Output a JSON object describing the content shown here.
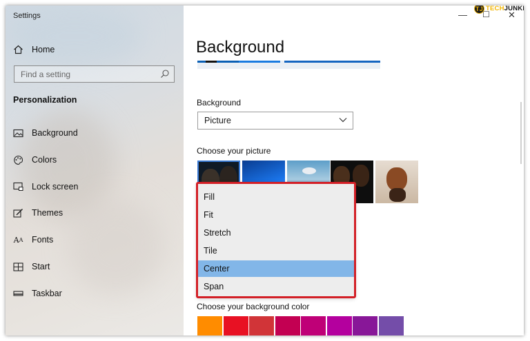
{
  "window": {
    "title": "Settings",
    "minimize": "—",
    "maximize": "☐",
    "close": "✕"
  },
  "watermark": {
    "letter": "TJ",
    "prefix": "TECH",
    "suffix": "JUNKIE"
  },
  "sidebar": {
    "home_label": "Home",
    "search_placeholder": "Find a setting",
    "section_title": "Personalization",
    "items": [
      {
        "label": "Background",
        "icon": "picture-icon"
      },
      {
        "label": "Colors",
        "icon": "palette-icon"
      },
      {
        "label": "Lock screen",
        "icon": "lock-screen-icon"
      },
      {
        "label": "Themes",
        "icon": "themes-icon"
      },
      {
        "label": "Fonts",
        "icon": "fonts-icon"
      },
      {
        "label": "Start",
        "icon": "start-icon"
      },
      {
        "label": "Taskbar",
        "icon": "taskbar-icon"
      }
    ]
  },
  "main": {
    "page_title": "Background",
    "background_label": "Background",
    "background_value": "Picture",
    "choose_picture_label": "Choose your picture",
    "choose_color_label": "Choose your background color",
    "colors": [
      "#ff8c00",
      "#e81123",
      "#d13438",
      "#c30052",
      "#bf0077",
      "#b4009e",
      "#881798",
      "#744da9"
    ]
  },
  "fit_dropdown": {
    "options": [
      "Fill",
      "Fit",
      "Stretch",
      "Tile",
      "Center",
      "Span"
    ],
    "selected": "Center",
    "highlight_color": "#d31f26",
    "selected_color": "#82b6e8"
  }
}
